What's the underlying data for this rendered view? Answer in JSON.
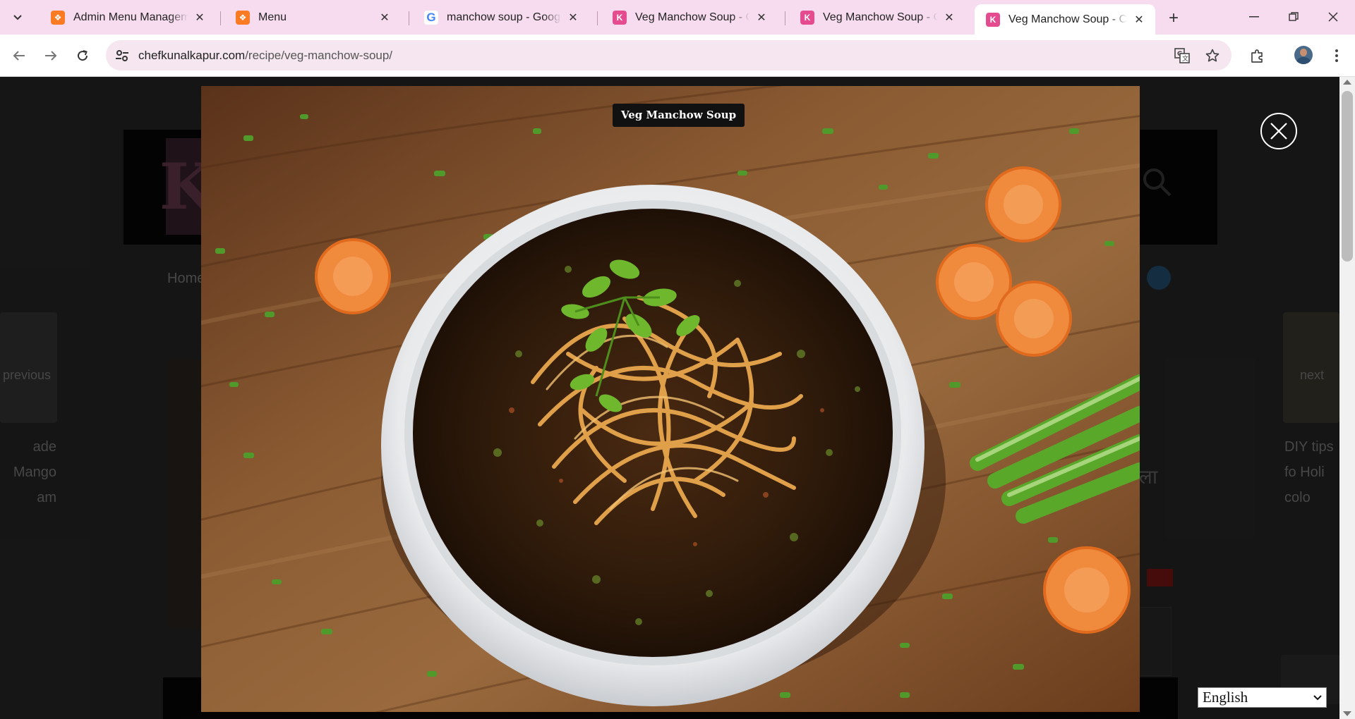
{
  "browser": {
    "tabs": [
      {
        "title": "Admin Menu Management",
        "favicon": "xampp-icon",
        "active": false
      },
      {
        "title": "Menu",
        "favicon": "xampp-icon",
        "active": false
      },
      {
        "title": "manchow soup - Google Search",
        "favicon": "google-icon",
        "active": false
      },
      {
        "title": "Veg Manchow Soup - Chef Kunal Kapur",
        "favicon": "chefkunal-icon",
        "active": false
      },
      {
        "title": "Veg Manchow Soup - Chef Kunal Kapur",
        "favicon": "chefkunal-icon",
        "active": false
      },
      {
        "title": "Veg Manchow Soup - Chef Kunal Kapur",
        "favicon": "chefkunal-icon",
        "active": true
      }
    ],
    "address": {
      "domain": "chefkunalkapur.com",
      "path": "/recipe/veg-manchow-soup/"
    }
  },
  "page": {
    "nav_home": "Home",
    "prev_label": "previous",
    "next_label": "next",
    "prev_title": "ade Mango am",
    "next_title": "DIY tips fo Holi colo",
    "hindi_fragment": "ाला"
  },
  "lightbox": {
    "caption": "Veg Manchow Soup",
    "image_subject": "bowl of veg manchow soup topped with crispy noodles and coriander on a wooden table with carrot slices and spring onions"
  },
  "language_select": {
    "value": "English"
  },
  "colors": {
    "tabbar_bg": "#f7dcf0",
    "omnibox_bg": "#f5e6f0",
    "caption_bg": "#111111"
  }
}
